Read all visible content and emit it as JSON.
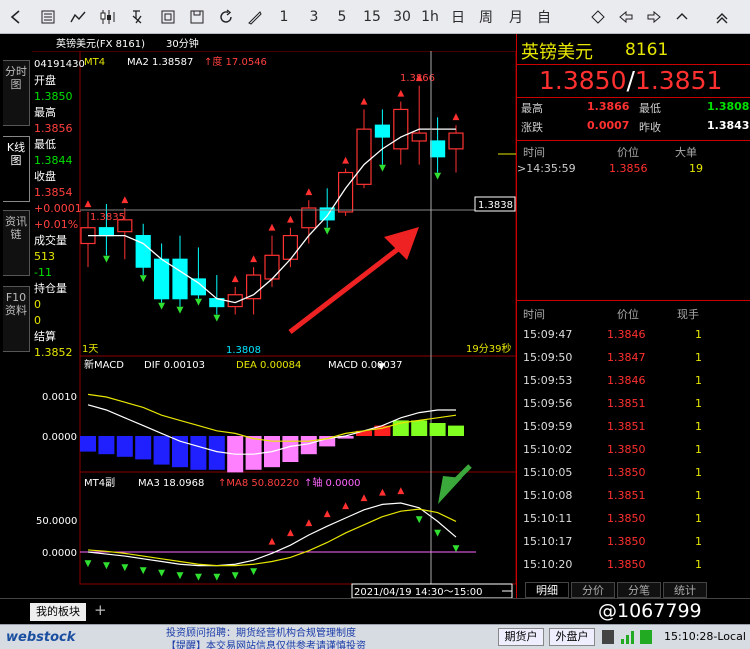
{
  "toolbar": {
    "icons": [
      "back-icon",
      "list-icon",
      "line-chart-icon",
      "pinyin-icon",
      "compute-icon",
      "grid-icon",
      "save-icon",
      "refresh-icon",
      "draw-icon"
    ],
    "periods": [
      "1",
      "3",
      "5",
      "15",
      "30",
      "1h",
      "日",
      "周",
      "月",
      "自"
    ],
    "nav_icons": [
      "diamond-icon",
      "x-icon",
      "arrow-left-icon",
      "arrow-right-icon",
      "arrow-up-icon",
      "arrow-down-icon"
    ]
  },
  "sidetabs": [
    "分时图",
    "K线图",
    "资讯链",
    "F10资料"
  ],
  "chart": {
    "header": "英镑美元(FX 8161)",
    "period": "30分钟",
    "mt4_label": "MT4",
    "mt4_values": "MA2 1.38587",
    "mt4_values2": "度 17.0546",
    "info": {
      "code": "04191430",
      "items": [
        {
          "label": "开盘",
          "value": "1.3850"
        },
        {
          "label": "最高",
          "value": "1.3856"
        },
        {
          "label": "最低",
          "value": "1.3844"
        },
        {
          "label": "收盘",
          "value": "1.3854"
        },
        {
          "label": "",
          "value": "+0.0001"
        },
        {
          "label": "",
          "value": "+0.01%"
        },
        {
          "label": "成交量",
          "value": "513"
        },
        {
          "label": "",
          "value": "-11"
        },
        {
          "label": "持仓量",
          "value": "0"
        },
        {
          "label": "",
          "value": "0"
        },
        {
          "label": "结算",
          "value": "1.3852"
        }
      ]
    },
    "high_label": "1.3866",
    "low_label": "1.3808",
    "left_label": "1.3835",
    "price_tag": "1.3838",
    "bottom_left": "1天",
    "countdown": "19分39秒",
    "macd": {
      "name": "新MACD",
      "dif": "DIF 0.00103",
      "dea": "DEA 0.00084",
      "macd": "MACD 0.00037",
      "ticks": [
        "0.0010",
        "0.0000"
      ]
    },
    "mt4sub": {
      "name": "MT4副",
      "ma3": "MA3 18.0968",
      "ma8": "MA8 50.80220",
      "axis": "轴 0.0000",
      "ticks": [
        "50.0000",
        "0.0000"
      ]
    },
    "time_label": "2021/04/19 14:30～15:00",
    "colors": {
      "up": "#ff3333",
      "down": "#00ffff",
      "ma": "#ffffff",
      "yellow": "#e6e600",
      "magenta": "#ff66ff"
    }
  },
  "chart_data": {
    "type": "candlestick",
    "candles": [
      {
        "o": 1.3826,
        "h": 1.3834,
        "l": 1.382,
        "c": 1.383
      },
      {
        "o": 1.383,
        "h": 1.3836,
        "l": 1.3823,
        "c": 1.3828
      },
      {
        "o": 1.3829,
        "h": 1.3835,
        "l": 1.3822,
        "c": 1.3832
      },
      {
        "o": 1.3828,
        "h": 1.3831,
        "l": 1.3818,
        "c": 1.382
      },
      {
        "o": 1.3822,
        "h": 1.3826,
        "l": 1.3811,
        "c": 1.3812
      },
      {
        "o": 1.3822,
        "h": 1.3828,
        "l": 1.381,
        "c": 1.3812
      },
      {
        "o": 1.3817,
        "h": 1.3825,
        "l": 1.3812,
        "c": 1.3813
      },
      {
        "o": 1.3812,
        "h": 1.3818,
        "l": 1.3808,
        "c": 1.381
      },
      {
        "o": 1.381,
        "h": 1.3815,
        "l": 1.3808,
        "c": 1.3813
      },
      {
        "o": 1.3812,
        "h": 1.382,
        "l": 1.3808,
        "c": 1.3818
      },
      {
        "o": 1.3817,
        "h": 1.3828,
        "l": 1.3815,
        "c": 1.3823
      },
      {
        "o": 1.3822,
        "h": 1.383,
        "l": 1.382,
        "c": 1.3828
      },
      {
        "o": 1.383,
        "h": 1.3837,
        "l": 1.3826,
        "c": 1.3835
      },
      {
        "o": 1.3835,
        "h": 1.384,
        "l": 1.383,
        "c": 1.3832
      },
      {
        "o": 1.3834,
        "h": 1.3845,
        "l": 1.3833,
        "c": 1.3844
      },
      {
        "o": 1.3841,
        "h": 1.386,
        "l": 1.384,
        "c": 1.3855
      },
      {
        "o": 1.3856,
        "h": 1.386,
        "l": 1.3846,
        "c": 1.3853
      },
      {
        "o": 1.385,
        "h": 1.3862,
        "l": 1.3846,
        "c": 1.386
      },
      {
        "o": 1.3852,
        "h": 1.3866,
        "l": 1.3846,
        "c": 1.3854
      },
      {
        "o": 1.3852,
        "h": 1.3858,
        "l": 1.3844,
        "c": 1.3848
      },
      {
        "o": 1.385,
        "h": 1.3856,
        "l": 1.3844,
        "c": 1.3854
      }
    ],
    "ma": [
      1.3828,
      1.3828,
      1.3828,
      1.3826,
      1.3822,
      1.3819,
      1.3816,
      1.3812,
      1.3811,
      1.3813,
      1.3817,
      1.3822,
      1.3828,
      1.3833,
      1.384,
      1.3846,
      1.385,
      1.3853,
      1.3855,
      1.3855,
      1.3855
    ],
    "macd_hist": [
      -0.0006,
      -0.0007,
      -0.0008,
      -0.0009,
      -0.0011,
      -0.0012,
      -0.0013,
      -0.0013,
      -0.0014,
      -0.0013,
      -0.0012,
      -0.001,
      -0.0007,
      -0.0004,
      -0.0001,
      0.0002,
      0.0004,
      0.0006,
      0.0006,
      0.0005,
      0.0004
    ],
    "macd_dif": [
      0.0012,
      0.001,
      0.0007,
      0.0004,
      0.0001,
      -0.0002,
      -0.0004,
      -0.0006,
      -0.0007,
      -0.0007,
      -0.0006,
      -0.0004,
      -0.0003,
      -0.0001,
      0.0,
      0.0002,
      0.0004,
      0.0007,
      0.0009,
      0.001,
      0.001
    ],
    "macd_dea": [
      0.0016,
      0.0015,
      0.0013,
      0.0011,
      0.0008,
      0.0006,
      0.0004,
      0.0002,
      0.0001,
      -0.0001,
      -0.0002,
      -0.0002,
      -0.0002,
      -0.0001,
      0.0001,
      0.0002,
      0.0003,
      0.0005,
      0.0006,
      0.0007,
      0.0008
    ],
    "sub_ma3": [
      0.0,
      -3.0,
      -6.0,
      -10.0,
      -14.0,
      -18.0,
      -20.0,
      -20.0,
      -18.0,
      -12.0,
      -2.0,
      10.0,
      25.0,
      38.0,
      50.0,
      62.0,
      70.0,
      72.0,
      65.0,
      45.0,
      22.0
    ],
    "sub_ma8": [
      3.0,
      1.0,
      -2.0,
      -6.0,
      -10.0,
      -14.0,
      -18.0,
      -20.0,
      -20.0,
      -18.0,
      -14.0,
      -8.0,
      2.0,
      14.0,
      28.0,
      40.0,
      52.0,
      60.0,
      63.0,
      58.0,
      45.0
    ]
  },
  "quote": {
    "name": "英镑美元",
    "code": "8161",
    "bid": "1.3850",
    "ask": "1.3851",
    "stats": [
      {
        "l": "最高",
        "v": "1.3866",
        "l2": "最低",
        "v2": "1.3808"
      },
      {
        "l": "涨跌",
        "v": "0.0007",
        "l2": "昨收",
        "v2": "1.3843"
      }
    ],
    "big_head": [
      "时间",
      "价位",
      "大单"
    ],
    "big_row": {
      "t": "14:35:59",
      "p": "1.3856",
      "v": "19"
    },
    "ticks_head": [
      "时间",
      "价位",
      "现手"
    ],
    "ticks": [
      {
        "t": "15:09:47",
        "p": "1.3846",
        "v": "1"
      },
      {
        "t": "15:09:50",
        "p": "1.3847",
        "v": "1"
      },
      {
        "t": "15:09:53",
        "p": "1.3846",
        "v": "1"
      },
      {
        "t": "15:09:56",
        "p": "1.3851",
        "v": "1"
      },
      {
        "t": "15:09:59",
        "p": "1.3851",
        "v": "1"
      },
      {
        "t": "15:10:02",
        "p": "1.3850",
        "v": "1"
      },
      {
        "t": "15:10:05",
        "p": "1.3850",
        "v": "1"
      },
      {
        "t": "15:10:08",
        "p": "1.3851",
        "v": "1"
      },
      {
        "t": "15:10:11",
        "p": "1.3850",
        "v": "1"
      },
      {
        "t": "15:10:17",
        "p": "1.3850",
        "v": "1"
      },
      {
        "t": "15:10:20",
        "p": "1.3850",
        "v": "1"
      }
    ],
    "tabs": [
      "明细",
      "分价",
      "分笔",
      "统计"
    ]
  },
  "bottombar": {
    "tab": "我的板块",
    "add": "+"
  },
  "statusbar": {
    "logo": "webstock",
    "ticker1": "投资顾问招聘：期货经营机构合规管理制度",
    "ticker2": "【提醒】本交易网站信息仅供参考请谨慎投资",
    "btn1": "期货户",
    "btn2": "外盘户",
    "time": "15:10:28-Local",
    "watermark": "@1067799"
  }
}
